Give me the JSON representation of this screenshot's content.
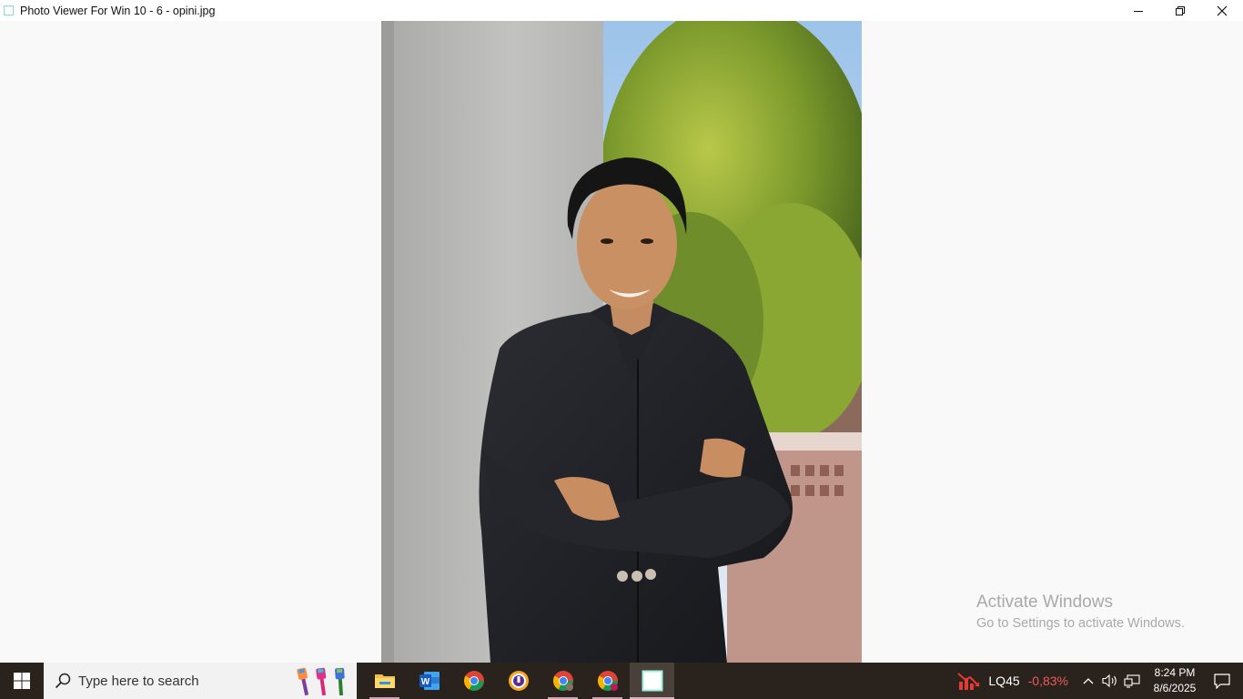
{
  "window": {
    "title": "Photo Viewer For Win 10 - 6 - opini.jpg",
    "icon": "photo-viewer-app-icon",
    "controls": [
      "minimize-icon",
      "restore-icon",
      "close-icon"
    ]
  },
  "photo": {
    "description_icon": "portrait-photo"
  },
  "watermark": {
    "title": "Activate Windows",
    "subtitle": "Go to Settings to activate Windows."
  },
  "taskbar": {
    "search": {
      "placeholder": "Type here to search"
    },
    "apps": [
      {
        "name": "file-explorer-icon"
      },
      {
        "name": "word-icon"
      },
      {
        "name": "chrome-icon"
      },
      {
        "name": "browser-shield-icon"
      },
      {
        "name": "chrome-profile-icon"
      },
      {
        "name": "chrome-profile-icon"
      },
      {
        "name": "photo-viewer-icon"
      }
    ],
    "tray": {
      "stock_name": "LQ45",
      "stock_change": "-0,83%",
      "stock_color": "#f05a5a",
      "time": "8:24 PM",
      "date": "8/6/2025"
    }
  },
  "colors": {
    "taskbar": "#2a221d",
    "accent": "#c9a4ae"
  }
}
